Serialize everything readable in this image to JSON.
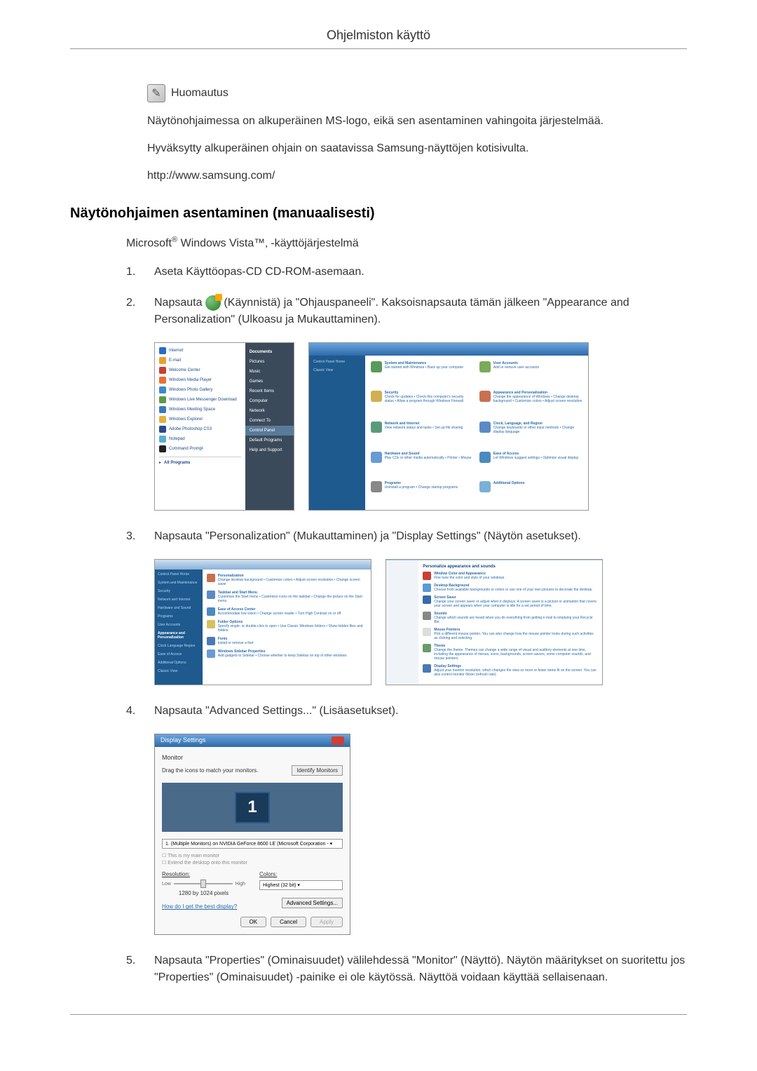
{
  "page_header": "Ohjelmiston käyttö",
  "note": {
    "label": "Huomautus",
    "line1": "Näytönohjaimessa on alkuperäinen MS-logo, eikä sen asentaminen vahingoita järjestelmää.",
    "line2": "Hyväksytty alkuperäinen ohjain on saatavissa Samsung-näyttöjen kotisivulta.",
    "line3": "http://www.samsung.com/"
  },
  "section_title": "Näytönohjaimen asentaminen (manuaalisesti)",
  "subtitle_prefix": "Microsoft",
  "subtitle_suffix": " Windows Vista™‚ -käyttöjärjestelmä",
  "steps": {
    "s1": {
      "num": "1.",
      "text": "Aseta Käyttöopas-CD CD-ROM-asemaan."
    },
    "s2": {
      "num": "2.",
      "text_a": "Napsauta ",
      "text_b": "(Käynnistä) ja \"Ohjauspaneeli\". Kaksoisnapsauta tämän jälkeen \"Appearance and Personalization\" (Ulkoasu ja Mukauttaminen)."
    },
    "s3": {
      "num": "3.",
      "text": "Napsauta \"Personalization\" (Mukauttaminen) ja \"Display Settings\" (Näytön asetukset)."
    },
    "s4": {
      "num": "4.",
      "text": "Napsauta \"Advanced Settings...\" (Lisäasetukset)."
    },
    "s5": {
      "num": "5.",
      "text": "Napsauta \"Properties\" (Ominaisuudet) välilehdessä \"Monitor\" (Näyttö). Näytön määritykset on suoritettu jos \"Properties\" (Ominaisuudet) -painike ei ole käytössä. Näyttöä voidaan käyttää sellaisenaan."
    }
  },
  "screenshot1": {
    "items": [
      "Internet",
      "E-mail",
      "Welcome Center",
      "Windows Media Player",
      "Windows Photo Gallery",
      "Windows Live Messenger Download",
      "Windows Meeting Space",
      "Windows Explorer",
      "Adobe Photoshop CS3",
      "Notepad",
      "Command Prompt",
      "All Programs"
    ],
    "menu": [
      "Documents",
      "Pictures",
      "Music",
      "Games",
      "Recent Items",
      "Computer",
      "Network",
      "Connect To",
      "Control Panel",
      "Default Programs",
      "Help and Support"
    ]
  },
  "screenshot2": {
    "sidebar": [
      "Control Panel Home",
      "Classic View"
    ],
    "categories": [
      {
        "title": "System and Maintenance",
        "sub": "Get started with Windows • Back up your computer"
      },
      {
        "title": "User Accounts",
        "sub": "Add or remove user accounts"
      },
      {
        "title": "Security",
        "sub": "Check for updates • Check this computer's security status • Allow a program through Windows Firewall"
      },
      {
        "title": "Appearance and Personalization",
        "sub": "Change the appearance of Windows • Change desktop background • Customize colors • Adjust screen resolution"
      },
      {
        "title": "Network and Internet",
        "sub": "View network status and tasks • Set up file sharing"
      },
      {
        "title": "Clock, Language, and Region",
        "sub": "Change keyboards or other input methods • Change display language"
      },
      {
        "title": "Hardware and Sound",
        "sub": "Play CDs or other media automatically • Printer • Mouse"
      },
      {
        "title": "Ease of Access",
        "sub": "Let Windows suggest settings • Optimize visual display"
      },
      {
        "title": "Programs",
        "sub": "Uninstall a program • Change startup programs"
      },
      {
        "title": "Additional Options",
        "sub": ""
      }
    ]
  },
  "screenshot3": {
    "sidebar": [
      "Control Panel Home",
      "System and Maintenance",
      "Security",
      "Network and Internet",
      "Hardware and Sound",
      "Programs",
      "User Accounts",
      "Appearance and Personalization",
      "Clock Language Region",
      "Ease of Access",
      "Additional Options",
      "Classic View"
    ],
    "items": [
      {
        "title": "Personalization",
        "sub": "Change desktop background • Customize colors • Adjust screen resolution • Change screen saver"
      },
      {
        "title": "Taskbar and Start Menu",
        "sub": "Customize the Start menu • Customize icons on the taskbar • Change the picture on the Start menu"
      },
      {
        "title": "Ease of Access Center",
        "sub": "Accommodate low vision • Change screen reader • Turn High Contrast on or off"
      },
      {
        "title": "Folder Options",
        "sub": "Specify single- or double-click to open • Use Classic Windows folders • Show hidden files and folders"
      },
      {
        "title": "Fonts",
        "sub": "Install or remove a font"
      },
      {
        "title": "Windows Sidebar Properties",
        "sub": "Add gadgets to Sidebar • Choose whether to keep Sidebar on top of other windows"
      }
    ]
  },
  "screenshot4": {
    "heading": "Personalize appearance and sounds",
    "items": [
      {
        "title": "Window Color and Appearance",
        "sub": "Fine tune the color and style of your windows."
      },
      {
        "title": "Desktop Background",
        "sub": "Choose from available backgrounds or colors or use one of your own pictures to decorate the desktop."
      },
      {
        "title": "Screen Saver",
        "sub": "Change your screen saver or adjust when it displays. A screen saver is a picture or animation that covers your screen and appears when your computer is idle for a set period of time."
      },
      {
        "title": "Sounds",
        "sub": "Change which sounds are heard when you do everything from getting e-mail to emptying your Recycle Bin."
      },
      {
        "title": "Mouse Pointers",
        "sub": "Pick a different mouse pointer. You can also change how the mouse pointer looks during such activities as clicking and selecting."
      },
      {
        "title": "Theme",
        "sub": "Change the theme. Themes can change a wide range of visual and auditory elements at one time, including the appearance of menus, icons, backgrounds, screen savers, some computer sounds, and mouse pointers."
      },
      {
        "title": "Display Settings",
        "sub": "Adjust your monitor resolution, which changes the view so more or fewer items fit on the screen. You can also control monitor flicker (refresh rate)."
      }
    ]
  },
  "screenshot5": {
    "title": "Display Settings",
    "tab": "Monitor",
    "drag_text": "Drag the icons to match your monitors.",
    "identify_btn": "Identify Monitors",
    "monitor_num": "1",
    "dropdown": "1. (Multiple Monitors) on NVIDIA GeForce 8600 LE (Microsoft Corporation - ▾",
    "check1": "This is my main monitor",
    "check2": "Extend the desktop onto this monitor",
    "resolution_label": "Resolution:",
    "low": "Low",
    "high": "High",
    "res_value": "1280 by 1024 pixels",
    "colors_label": "Colors:",
    "colors_value": "Highest (32 bit)   ▾",
    "help_link": "How do I get the best display?",
    "advanced_btn": "Advanced Settings...",
    "ok": "OK",
    "cancel": "Cancel",
    "apply": "Apply"
  }
}
